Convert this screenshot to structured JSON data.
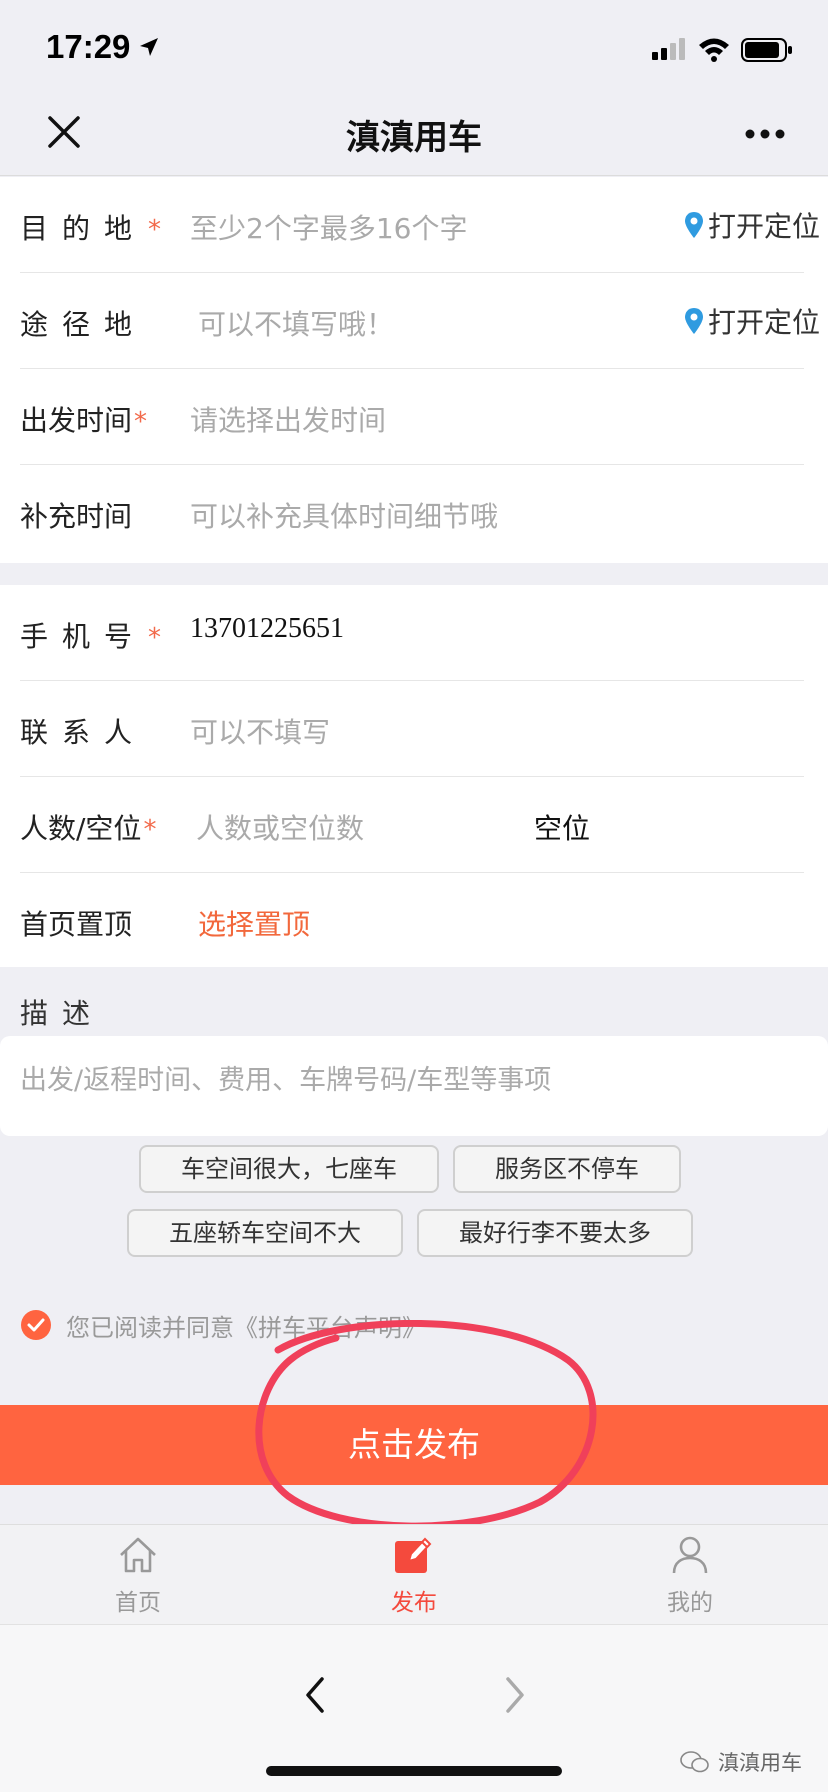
{
  "status": {
    "time": "17:29"
  },
  "nav": {
    "title": "滇滇用车"
  },
  "route": {
    "destination": {
      "label": "目的地",
      "placeholder": "至少2个字最多16个字",
      "locate": "打开定位"
    },
    "waypoint": {
      "label": "途径地",
      "placeholder": "可以不填写哦！",
      "locate": "打开定位"
    },
    "depart_time": {
      "label": "出发时间",
      "placeholder": "请选择出发时间"
    },
    "extra_time": {
      "label": "补充时间",
      "placeholder": "可以补充具体时间细节哦"
    }
  },
  "contact": {
    "phone": {
      "label": "手机号",
      "value": "13701225651"
    },
    "name": {
      "label": "联系人",
      "placeholder": "可以不填写"
    },
    "seats": {
      "label": "人数/空位",
      "placeholder": "人数或空位数",
      "unit": "空位"
    },
    "pin": {
      "label": "首页置顶",
      "link": "选择置顶"
    }
  },
  "required_mark": "*",
  "description": {
    "label": "描述",
    "placeholder": "出发/返程时间、费用、车牌号码/车型等事项",
    "chips": [
      "车空间很大，七座车",
      "服务区不停车",
      "五座轿车空间不大",
      "最好行李不要太多"
    ]
  },
  "agreement": {
    "text": "您已阅读并同意《拼车平台声明》",
    "checked": true
  },
  "publish_button": "点击发布",
  "tabs": [
    {
      "label": "首页",
      "icon": "home-icon",
      "active": false
    },
    {
      "label": "发布",
      "icon": "edit-icon",
      "active": true
    },
    {
      "label": "我的",
      "icon": "user-icon",
      "active": false
    }
  ],
  "watermark": "滇滇用车",
  "colors": {
    "accent": "#ff6440",
    "active_tab": "#f44a3d",
    "pin_blue": "#2f9be0",
    "annotation": "#f0405a"
  }
}
